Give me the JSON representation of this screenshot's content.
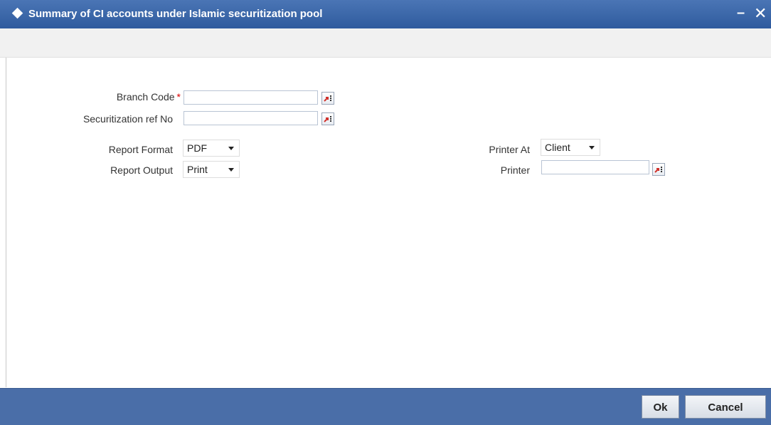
{
  "window": {
    "title": "Summary of CI accounts under Islamic securitization pool",
    "minimize_glyph": "–",
    "close_glyph": "✕"
  },
  "form": {
    "branch_code": {
      "label": "Branch Code",
      "required_mark": "*",
      "value": "",
      "lov_icon": "lov-icon"
    },
    "securitization_ref_no": {
      "label": "Securitization ref No",
      "value": "",
      "lov_icon": "lov-icon"
    },
    "report_format": {
      "label": "Report Format",
      "selected": "PDF"
    },
    "report_output": {
      "label": "Report Output",
      "selected": "Print"
    },
    "printer_at": {
      "label": "Printer At",
      "selected": "Client"
    },
    "printer": {
      "label": "Printer",
      "value": "",
      "lov_icon": "lov-icon"
    }
  },
  "footer": {
    "ok_label": "Ok",
    "cancel_label": "Cancel"
  },
  "colors": {
    "title_bar": "#2f5b9e",
    "footer_bar": "#4a6ea8",
    "required": "#dd0000"
  }
}
